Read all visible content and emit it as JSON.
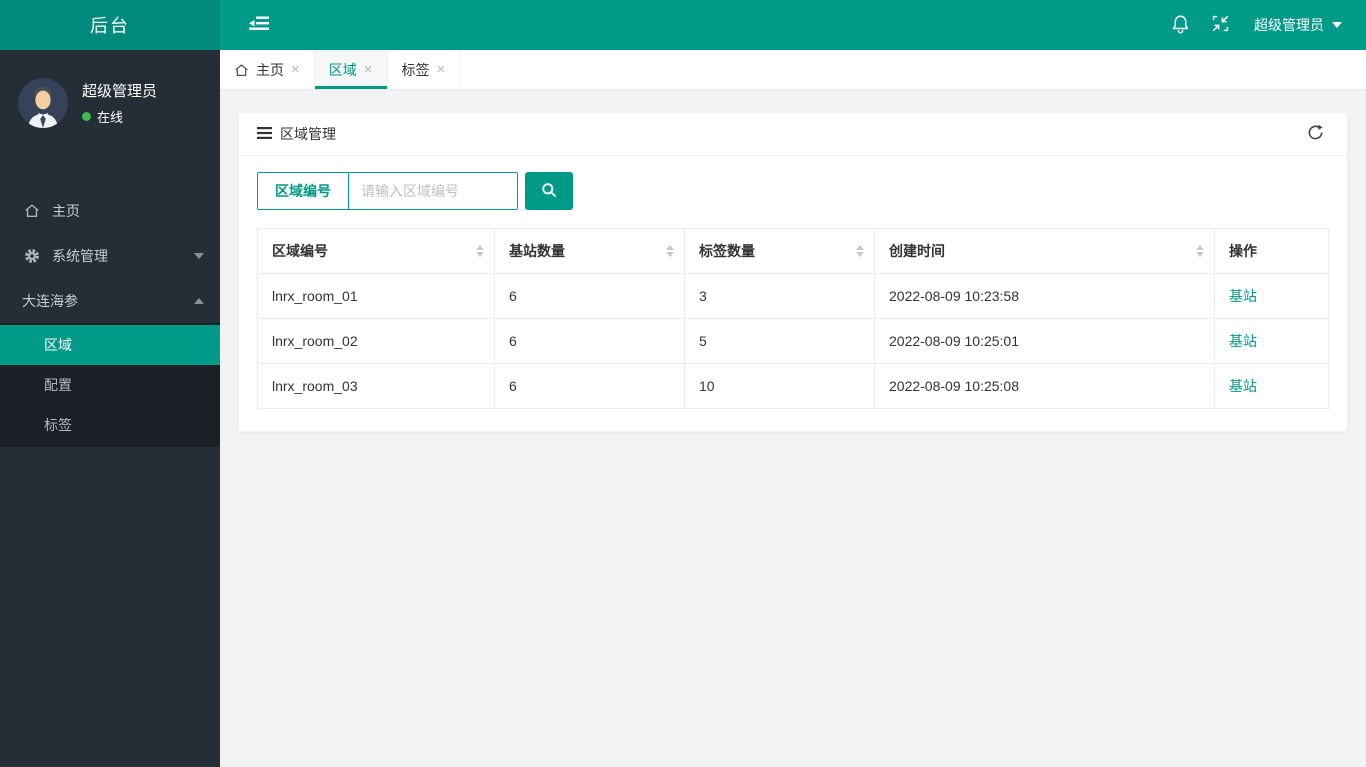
{
  "app": {
    "title": "后台"
  },
  "header": {
    "user_label": "超级管理员",
    "icons": {
      "toggle": "menu-fold",
      "bell": "notifications",
      "compress": "fullscreen-exit"
    }
  },
  "sidebar": {
    "user_name": "超级管理员",
    "user_status": "在线",
    "menu": {
      "home": "主页",
      "system": "系统管理",
      "group": "大连海参",
      "sub_region": "区域",
      "sub_config": "配置",
      "sub_tag": "标签"
    }
  },
  "tabs": {
    "home": "主页",
    "region": "区域",
    "tag": "标签",
    "close_glyph": "×"
  },
  "panel": {
    "title": "区域管理",
    "search_label": "区域编号",
    "search_placeholder": "请输入区域编号"
  },
  "table": {
    "columns": [
      "区域编号",
      "基站数量",
      "标签数量",
      "创建时间",
      "操作"
    ],
    "rows": [
      {
        "region_id": "lnrx_room_01",
        "base_stations": "6",
        "tag_count": "3",
        "created_at": "2022-08-09 10:23:58",
        "action": "基站"
      },
      {
        "region_id": "lnrx_room_02",
        "base_stations": "6",
        "tag_count": "5",
        "created_at": "2022-08-09 10:25:01",
        "action": "基站"
      },
      {
        "region_id": "lnrx_room_03",
        "base_stations": "6",
        "tag_count": "10",
        "created_at": "2022-08-09 10:25:08",
        "action": "基站"
      }
    ]
  },
  "colors": {
    "primary_teal": "#009a88",
    "logo_teal": "#008a7b",
    "sidebar_bg": "#252d36",
    "submenu_bg": "#1b2027",
    "online_green": "#3fba51",
    "content_bg": "#f2f2f2"
  }
}
